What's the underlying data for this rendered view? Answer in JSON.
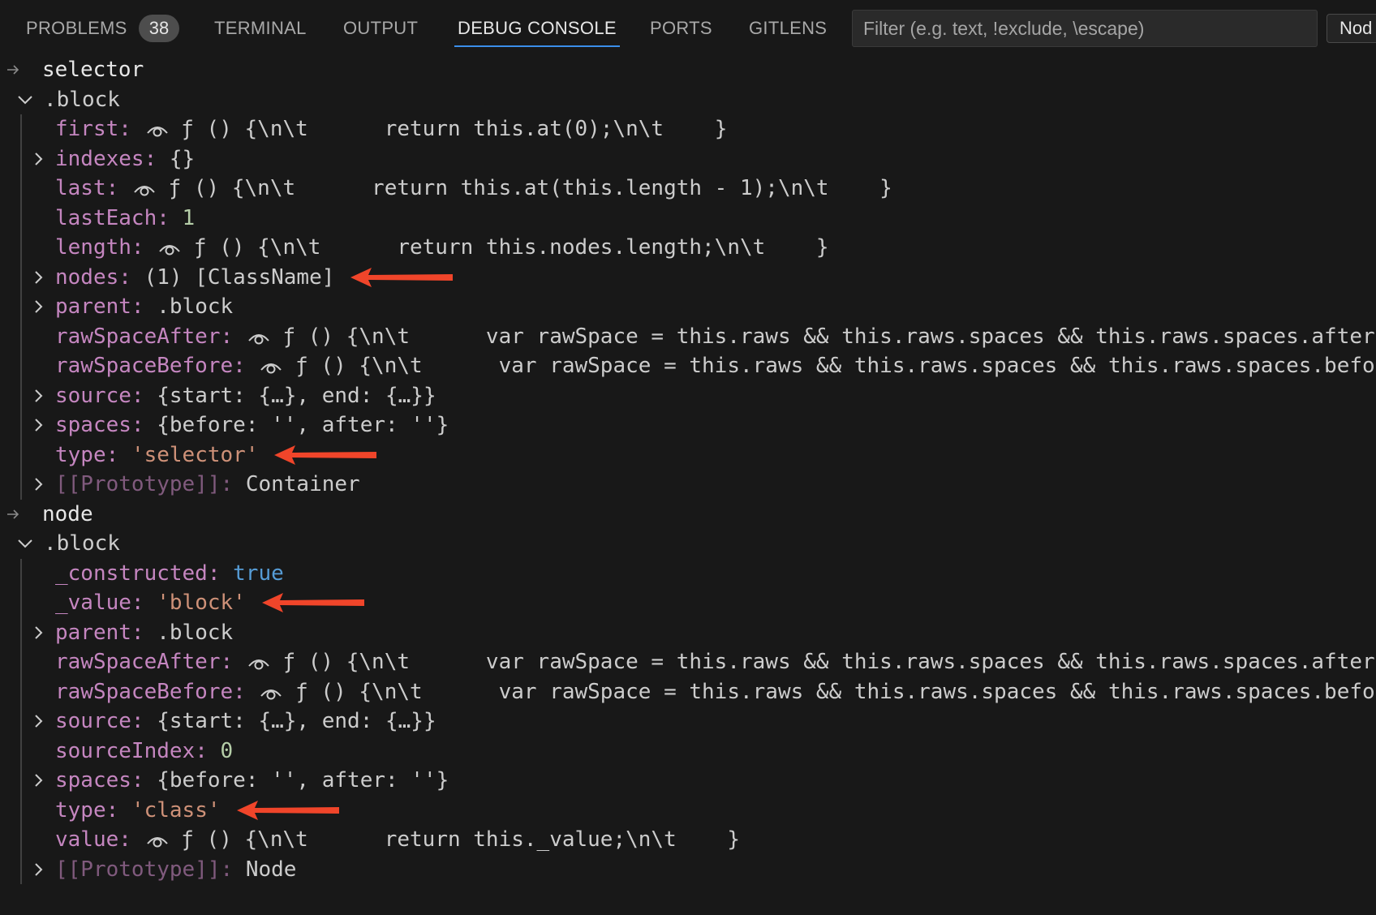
{
  "tabs": [
    {
      "label": "PROBLEMS",
      "badge": "38"
    },
    {
      "label": "TERMINAL"
    },
    {
      "label": "OUTPUT"
    },
    {
      "label": "DEBUG CONSOLE",
      "active": true
    },
    {
      "label": "PORTS"
    },
    {
      "label": "GITLENS"
    }
  ],
  "filter": {
    "placeholder": "Filter (e.g. text, !exclude, \\escape)"
  },
  "session_button": "Nod",
  "sections": [
    {
      "expression": "selector",
      "object": ".block",
      "properties": [
        {
          "key": "first",
          "getter": true,
          "value": "ƒ () {\\n\\t      return this.at(0);\\n\\t    }"
        },
        {
          "key": "indexes",
          "expandable": true,
          "value": "{}"
        },
        {
          "key": "last",
          "getter": true,
          "value": "ƒ () {\\n\\t      return this.at(this.length - 1);\\n\\t    }"
        },
        {
          "key": "lastEach",
          "value": "1",
          "kind": "number"
        },
        {
          "key": "length",
          "getter": true,
          "value": "ƒ () {\\n\\t      return this.nodes.length;\\n\\t    }"
        },
        {
          "key": "nodes",
          "expandable": true,
          "value": "(1) [ClassName]",
          "annotated": true
        },
        {
          "key": "parent",
          "expandable": true,
          "value": ".block"
        },
        {
          "key": "rawSpaceAfter",
          "getter": true,
          "value": "ƒ () {\\n\\t      var rawSpace = this.raws && this.raws.spaces && this.raws.spaces.after;"
        },
        {
          "key": "rawSpaceBefore",
          "getter": true,
          "value": "ƒ () {\\n\\t      var rawSpace = this.raws && this.raws.spaces && this.raws.spaces.before"
        },
        {
          "key": "source",
          "expandable": true,
          "value": "{start: {…}, end: {…}}"
        },
        {
          "key": "spaces",
          "expandable": true,
          "value": "{before: '', after: ''}"
        },
        {
          "key": "type",
          "value": "'selector'",
          "kind": "string",
          "annotated": true
        },
        {
          "key": "[[Prototype]]",
          "expandable": true,
          "value": "Container",
          "kind": "proto"
        }
      ]
    },
    {
      "expression": "node",
      "object": ".block",
      "properties": [
        {
          "key": "_constructed",
          "value": "true",
          "kind": "boolean"
        },
        {
          "key": "_value",
          "value": "'block'",
          "kind": "string",
          "annotated": true
        },
        {
          "key": "parent",
          "expandable": true,
          "value": ".block"
        },
        {
          "key": "rawSpaceAfter",
          "getter": true,
          "value": "ƒ () {\\n\\t      var rawSpace = this.raws && this.raws.spaces && this.raws.spaces.after;"
        },
        {
          "key": "rawSpaceBefore",
          "getter": true,
          "value": "ƒ () {\\n\\t      var rawSpace = this.raws && this.raws.spaces && this.raws.spaces.before"
        },
        {
          "key": "source",
          "expandable": true,
          "value": "{start: {…}, end: {…}}"
        },
        {
          "key": "sourceIndex",
          "value": "0",
          "kind": "number"
        },
        {
          "key": "spaces",
          "expandable": true,
          "value": "{before: '', after: ''}"
        },
        {
          "key": "type",
          "value": "'class'",
          "kind": "string",
          "annotated": true
        },
        {
          "key": "value",
          "getter": true,
          "value": "ƒ () {\\n\\t      return this._value;\\n\\t    }"
        },
        {
          "key": "[[Prototype]]",
          "expandable": true,
          "value": "Node",
          "kind": "proto"
        }
      ]
    }
  ],
  "colors": {
    "background": "#181818",
    "key": "#c586c0",
    "string": "#ce9178",
    "number": "#b5cea8",
    "boolean": "#569cd6",
    "annotation_arrow": "#f0452a",
    "tab_underline": "#3b8eea"
  },
  "icons": {
    "expand": "chevron-right-icon",
    "collapse": "chevron-down-icon",
    "getter": "eye-icon",
    "input": "arrow-right-icon",
    "annotation": "red-arrow-icon"
  }
}
